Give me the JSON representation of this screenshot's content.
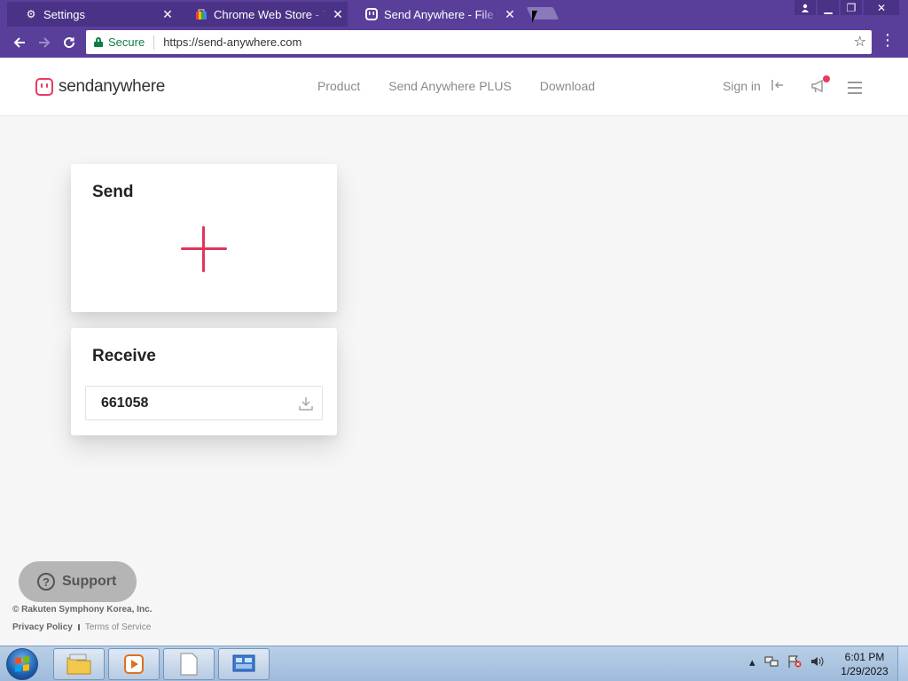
{
  "browser": {
    "tabs": [
      {
        "title": "Settings",
        "icon": "gear-icon"
      },
      {
        "title": "Chrome Web Store - The",
        "icon": "chrome-web-store-icon"
      },
      {
        "title": "Send Anywhere - File tra",
        "icon": "send-anywhere-icon"
      }
    ],
    "address": {
      "secure_label": "Secure",
      "url": "https://send-anywhere.com"
    }
  },
  "site": {
    "logo": {
      "bold": "send",
      "rest": "anywhere"
    },
    "nav": [
      "Product",
      "Send Anywhere PLUS",
      "Download"
    ],
    "signin_label": "Sign in",
    "accent_color": "#e0365b"
  },
  "send_card": {
    "title": "Send"
  },
  "receive_card": {
    "title": "Receive",
    "key_value": "661058"
  },
  "support": {
    "label": "Support"
  },
  "footer": {
    "copyright": "© Rakuten Symphony Korea, Inc.",
    "privacy": "Privacy Policy",
    "terms": "Terms of Service"
  },
  "taskbar": {
    "time": "6:01 PM",
    "date": "1/29/2023"
  }
}
